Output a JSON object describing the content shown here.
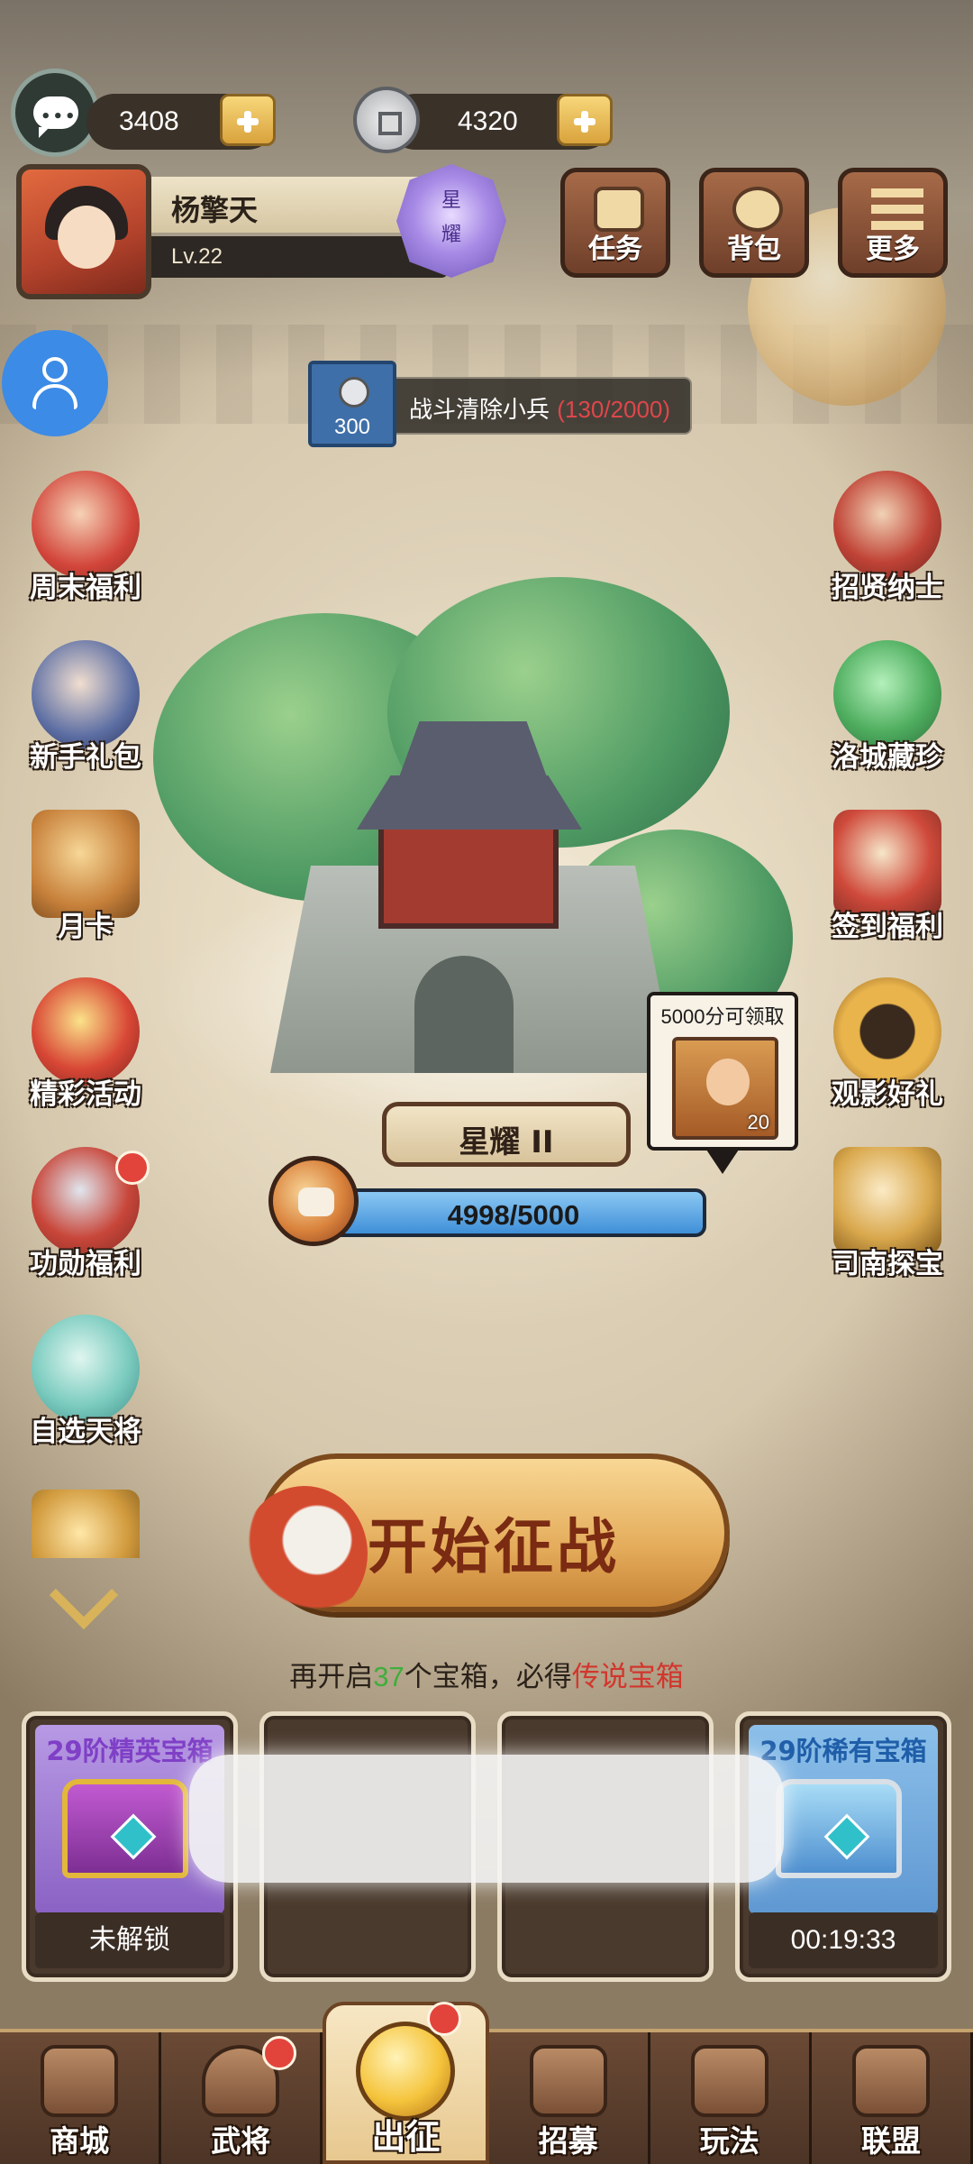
{
  "currencies": {
    "gold": "3408",
    "coins": "4320"
  },
  "player": {
    "name": "杨擎天",
    "level": "Lv.22",
    "rank_badge": "星耀"
  },
  "top_menu": {
    "tasks": "任务",
    "bag": "背包",
    "more": "更多"
  },
  "quest": {
    "reward": "300",
    "text": "战斗清除小兵",
    "progress": "(130/2000)"
  },
  "left_icons": {
    "weekend": "周末福利",
    "newbie": "新手礼包",
    "monthly_card": "月卡",
    "events": "精彩活动",
    "merit": "功勋福利",
    "select_general": "自选天将"
  },
  "right_icons": {
    "recruit_talent": "招贤纳士",
    "luocheng": "洛城藏珍",
    "checkin": "签到福利",
    "watch_ad": "观影好礼",
    "treasure": "司南探宝"
  },
  "stage": {
    "name": "星耀 II",
    "exp_text": "4998/5000",
    "exp_fraction": 0.9996,
    "reward_hint": "5000分可领取",
    "reward_count": "20"
  },
  "start_button": "开始征战",
  "chest_hint": {
    "prefix": "再开启",
    "count": "37",
    "middle": "个宝箱，必得",
    "reward": "传说宝箱"
  },
  "chest_slots": [
    {
      "title": "29阶精英宝箱",
      "status": "未解锁"
    },
    {
      "title": "",
      "status": ""
    },
    {
      "title": "",
      "status": ""
    },
    {
      "title": "29阶稀有宝箱",
      "status": "00:19:33"
    }
  ],
  "nav": {
    "shop": "商城",
    "generals": "武将",
    "battle": "出征",
    "recruit": "招募",
    "gameplay": "玩法",
    "alliance": "联盟"
  },
  "colors": {
    "quest_progress": "#e0464b",
    "hint_count": "#3fae3b",
    "hint_reward": "#d2362d",
    "elite_chest": "#9a66c8",
    "rare_chest": "#6aa2d6"
  }
}
